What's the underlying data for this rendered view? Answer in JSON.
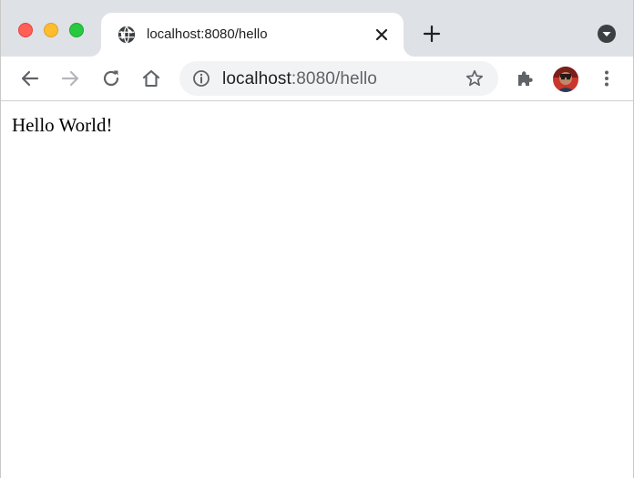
{
  "tab": {
    "title": "localhost:8080/hello",
    "favicon": "globe-icon"
  },
  "toolbar": {
    "back": "back-arrow-icon",
    "forward": "forward-arrow-icon",
    "reload": "reload-icon",
    "home": "home-icon"
  },
  "omnibox": {
    "host": "localhost",
    "rest": ":8080/hello",
    "info": "info-icon",
    "bookmark": "star-icon"
  },
  "extensions": {
    "icon": "puzzle-piece-icon"
  },
  "menu": {
    "icon": "vertical-dots-icon"
  },
  "page": {
    "text": "Hello World!"
  },
  "colors": {
    "tabstrip": "#dee1e6",
    "omnibox": "#f1f3f4",
    "close": "#ff5f57",
    "minimize": "#febc2e",
    "maximize": "#28c840"
  }
}
